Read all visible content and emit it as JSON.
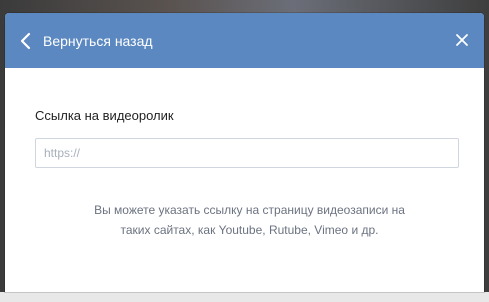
{
  "header": {
    "back_label": "Вернуться назад",
    "back_icon": "chevron-left-icon",
    "close_icon": "close-icon",
    "background_color": "#5b88c0"
  },
  "form": {
    "field_label": "Ссылка на видеоролик",
    "url_placeholder": "https://",
    "url_value": ""
  },
  "hint": {
    "line1": "Вы можете указать ссылку на страницу видеозаписи на",
    "line2": "таких сайтах, как Youtube, Rutube, Vimeo и др."
  }
}
